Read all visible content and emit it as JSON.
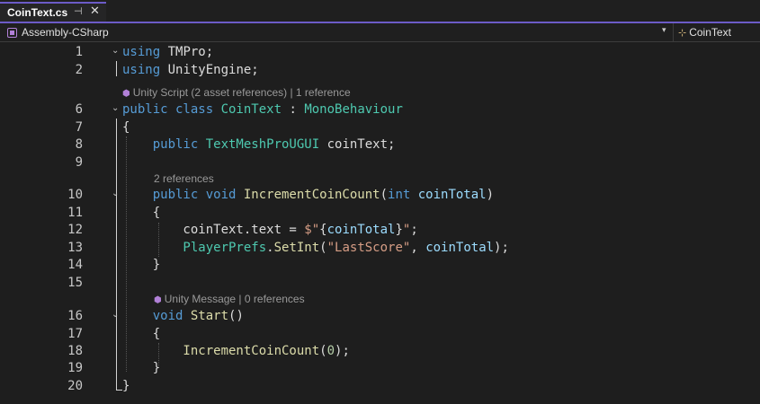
{
  "tab": {
    "title": "CoinText.cs",
    "pin_icon": "pin-icon",
    "close_icon": "close-icon"
  },
  "navbar": {
    "project": "Assembly-CSharp",
    "member": "CoinText"
  },
  "lenses": {
    "class_lens": "Unity Script (2 asset references) | 1 reference",
    "method_lens": "2 references",
    "start_lens": "Unity Message | 0 references"
  },
  "lines": [
    {
      "n": "1",
      "tokens": [
        [
          "kw",
          "using"
        ],
        [
          "tx",
          " TMPro;"
        ]
      ]
    },
    {
      "n": "2",
      "tokens": [
        [
          "kw",
          "using"
        ],
        [
          "tx",
          " UnityEngine;"
        ]
      ]
    },
    {
      "n": "6",
      "tokens": [
        [
          "kw",
          "public class "
        ],
        [
          "ty",
          "CoinText"
        ],
        [
          "tx",
          " : "
        ],
        [
          "ty",
          "MonoBehaviour"
        ]
      ]
    },
    {
      "n": "7",
      "tokens": [
        [
          "tx",
          "{"
        ]
      ]
    },
    {
      "n": "8",
      "tokens": [
        [
          "kw",
          "    public "
        ],
        [
          "ty",
          "TextMeshProUGUI"
        ],
        [
          "tx",
          " coinText;"
        ]
      ]
    },
    {
      "n": "9",
      "tokens": []
    },
    {
      "n": "10",
      "tokens": [
        [
          "kw",
          "    public void "
        ],
        [
          "fn",
          "IncrementCoinCount"
        ],
        [
          "tx",
          "("
        ],
        [
          "kw",
          "int "
        ],
        [
          "pr",
          "coinTotal"
        ],
        [
          "tx",
          ")"
        ]
      ]
    },
    {
      "n": "11",
      "tokens": [
        [
          "tx",
          "    {"
        ]
      ]
    },
    {
      "n": "12",
      "tokens": [
        [
          "tx",
          "        coinText.text = "
        ],
        [
          "st",
          "$\""
        ],
        [
          "tx",
          "{"
        ],
        [
          "pr",
          "coinTotal"
        ],
        [
          "tx",
          "}"
        ],
        [
          "st",
          "\""
        ],
        [
          "tx",
          ";"
        ]
      ]
    },
    {
      "n": "13",
      "tokens": [
        [
          "ty",
          "        PlayerPrefs"
        ],
        [
          "tx",
          "."
        ],
        [
          "fn",
          "SetInt"
        ],
        [
          "tx",
          "("
        ],
        [
          "st",
          "\"LastScore\""
        ],
        [
          "tx",
          ", "
        ],
        [
          "pr",
          "coinTotal"
        ],
        [
          "tx",
          ");"
        ]
      ]
    },
    {
      "n": "14",
      "tokens": [
        [
          "tx",
          "    }"
        ]
      ]
    },
    {
      "n": "15",
      "tokens": []
    },
    {
      "n": "16",
      "tokens": [
        [
          "kw",
          "    void "
        ],
        [
          "fn",
          "Start"
        ],
        [
          "tx",
          "()"
        ]
      ]
    },
    {
      "n": "17",
      "tokens": [
        [
          "tx",
          "    {"
        ]
      ]
    },
    {
      "n": "18",
      "tokens": [
        [
          "fn",
          "        IncrementCoinCount"
        ],
        [
          "tx",
          "("
        ],
        [
          "nm",
          "0"
        ],
        [
          "tx",
          ");"
        ]
      ]
    },
    {
      "n": "19",
      "tokens": [
        [
          "tx",
          "    }"
        ]
      ]
    },
    {
      "n": "20",
      "tokens": [
        [
          "tx",
          "}"
        ]
      ]
    }
  ],
  "colors": {
    "accent": "#6c5bc7",
    "keyword": "#569cd6",
    "type": "#4ec9b0",
    "method": "#dcdcaa",
    "param": "#9cdcfe",
    "string": "#d69d85",
    "number": "#b5cea8"
  }
}
